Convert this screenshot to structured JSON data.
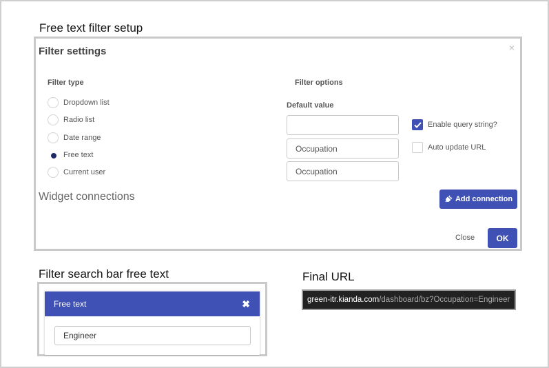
{
  "captions": {
    "setup": "Free text filter setup",
    "search_bar": "Filter search bar free text",
    "final_url": "Final URL"
  },
  "dialog": {
    "title": "Filter settings",
    "close_glyph": "×",
    "filter_type_label": "Filter type",
    "filter_types": [
      {
        "label": "Dropdown list",
        "selected": false
      },
      {
        "label": "Radio list",
        "selected": false
      },
      {
        "label": "Date range",
        "selected": false
      },
      {
        "label": "Free text",
        "selected": true
      },
      {
        "label": "Current user",
        "selected": false
      }
    ],
    "filter_options_label": "Filter options",
    "default_value_label": "Default value",
    "fields": [
      "",
      "Occupation",
      "Occupation"
    ],
    "enable_query_string": {
      "label": "Enable query string?",
      "checked": true
    },
    "auto_update_url": {
      "label": "Auto update URL",
      "checked": false
    },
    "widget_connections_label": "Widget connections",
    "add_connection_label": "Add connection",
    "close_label": "Close",
    "ok_label": "OK"
  },
  "search_bar": {
    "title": "Free text",
    "close_glyph": "✖",
    "value": "Engineer"
  },
  "url": {
    "host": "green-itr.kianda.com",
    "path": "/dashboard/bz?Occupation=Engineer"
  },
  "colors": {
    "accent": "#3f51b5",
    "radio_selected": "#1d2a63",
    "url_bar_bg": "#222222"
  },
  "icons": {
    "plug": "plug-icon",
    "check": "check-icon",
    "close": "close-icon"
  }
}
